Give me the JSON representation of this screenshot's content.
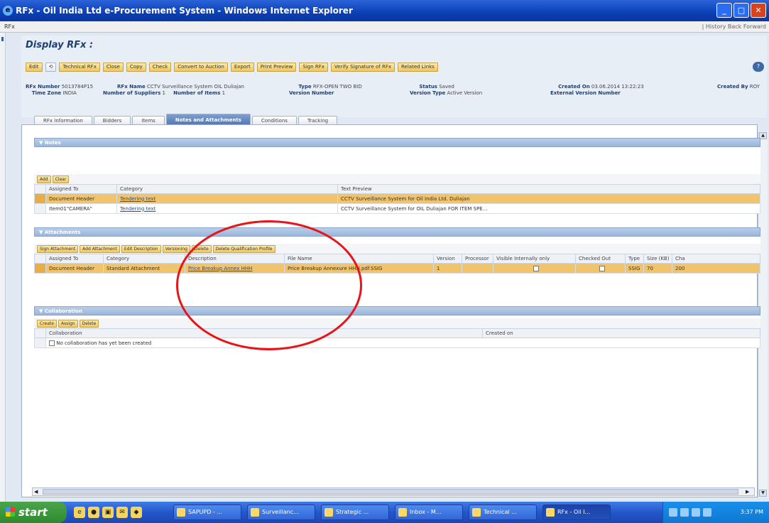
{
  "window": {
    "title": "RFx - Oil India Ltd e-Procurement System - Windows Internet Explorer",
    "menu_left": "RFx",
    "menu_right": "| History   Back  Forward"
  },
  "page": {
    "title": "Display RFx :",
    "toolbar": [
      "Edit",
      "Technical RFx",
      "Close",
      "Copy",
      "Check",
      "Convert to Auction",
      "Export",
      "Print Preview",
      "Sign RFx",
      "Verify Signature of RFx",
      "Related Links"
    ]
  },
  "header": {
    "rfx_number_label": "RFx Number",
    "rfx_number": "5013784P15",
    "time_zone_label": "Time Zone",
    "time_zone": "INDIA",
    "rfx_name_label": "RFx Name",
    "rfx_name": "CCTV Surveillance System OIL Duliajan",
    "num_suppliers_label": "Number of Suppliers",
    "num_suppliers": "1",
    "num_items_label": "Number of Items",
    "num_items": "1",
    "type_label": "Type",
    "type": "RFX-OPEN TWO BID",
    "version_number_label": "Version Number",
    "version_number": "",
    "status_label": "Status",
    "status": "Saved",
    "version_type_label": "Version Type",
    "version_type": "Active Version",
    "created_on_label": "Created On",
    "created_on": "03.06.2014 13:22:23",
    "ext_version_label": "External Version Number",
    "ext_version": "",
    "created_by_label": "Created By",
    "created_by": "ROY"
  },
  "tabs": [
    "RFx Information",
    "Bidders",
    "Items",
    "Notes and Attachments",
    "Conditions",
    "Tracking"
  ],
  "notes": {
    "header": "Notes",
    "buttons": [
      "Add",
      "Clear"
    ],
    "columns": [
      "Assigned To",
      "Category",
      "Text Preview"
    ],
    "rows": [
      [
        "Document Header",
        "Tendering text",
        "CCTV Surveillance System for Oil India Ltd. Duliajan"
      ],
      [
        "Item01\"CAMERA\"",
        "Tendering text",
        "CCTV Surveillance System for OIL Duliajan FOR ITEM SPE..."
      ]
    ]
  },
  "attachments": {
    "header": "Attachments",
    "buttons": [
      "Sign Attachment",
      "Add Attachment",
      "Edit Description",
      "Versioning",
      "Delete",
      "Delete Qualification Profile"
    ],
    "columns": [
      "Assigned To",
      "Category",
      "Description",
      "File Name",
      "Version",
      "Processor",
      "Visible Internally only",
      "Checked Out",
      "Type",
      "Size (KB)",
      "Cha"
    ],
    "rows": [
      [
        "Document Header",
        "Standard Attachment",
        "Price Breakup Annex HHH",
        "Price Breakup Annexure HHH.pdf.SSIG",
        "1",
        "",
        "",
        "",
        "SSIG",
        "70",
        "200"
      ]
    ]
  },
  "collaboration": {
    "header": "Collaboration",
    "buttons": [
      "Create",
      "Assign",
      "Delete"
    ],
    "columns": [
      "Collaboration",
      "Created on"
    ],
    "empty": "No collaboration has yet been created"
  },
  "taskbar": {
    "start": "start",
    "tasks": [
      "SAPUPD - ...",
      "Surveillanc...",
      "Strategic ...",
      "Inbox - M...",
      "Technical ...",
      "RFx - Oil I..."
    ],
    "clock": "3:37 PM"
  },
  "colors": {
    "highlight_row": "#f1c36b",
    "annotation_circle": "#e8141a",
    "section_header": "#9ab6dc"
  }
}
